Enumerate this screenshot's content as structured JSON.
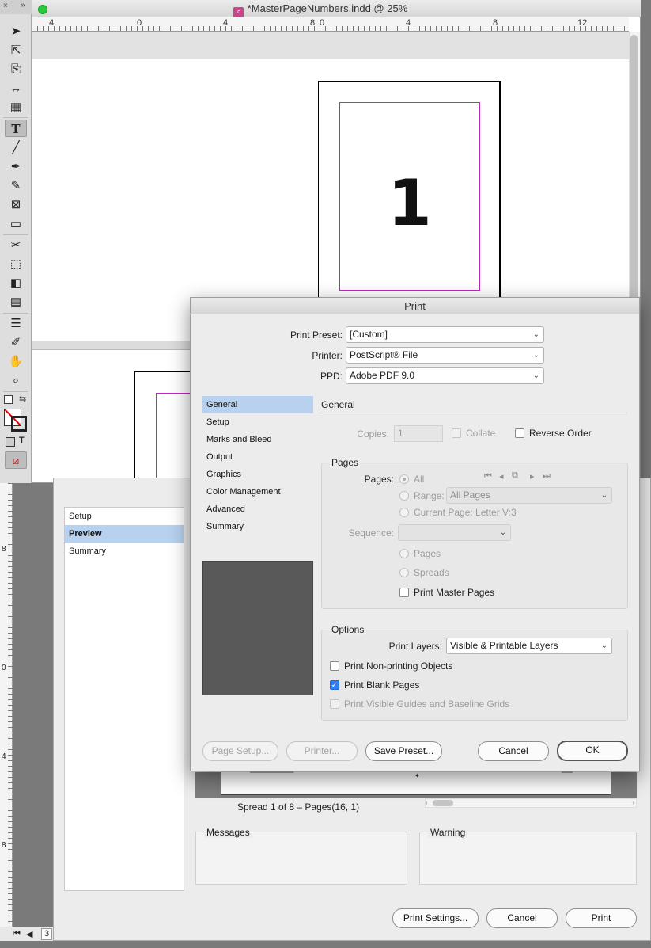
{
  "window": {
    "title": "*MasterPageNumbers.indd @ 25%",
    "ruler_top_labels": [
      "4",
      "0",
      "4",
      "8",
      "0",
      "4",
      "8",
      "12"
    ],
    "ruler_left_labels": [
      "8",
      "0",
      "4",
      "8"
    ],
    "page_number": "1",
    "page_field": "3"
  },
  "tools": [
    {
      "icon": "selection-arrow-icon",
      "glyph": "➤"
    },
    {
      "icon": "direct-selection-icon",
      "glyph": "⇱"
    },
    {
      "icon": "page-tool-icon",
      "glyph": "⎘"
    },
    {
      "icon": "gap-tool-icon",
      "glyph": "↔"
    },
    {
      "icon": "content-collector-icon",
      "glyph": "▦"
    },
    {
      "icon": "type-tool-icon",
      "glyph": "T"
    },
    {
      "icon": "line-tool-icon",
      "glyph": "╱"
    },
    {
      "icon": "pen-tool-icon",
      "glyph": "✒"
    },
    {
      "icon": "pencil-tool-icon",
      "glyph": "✎"
    },
    {
      "icon": "rectangle-frame-icon",
      "glyph": "⊠"
    },
    {
      "icon": "rectangle-tool-icon",
      "glyph": "▭"
    },
    {
      "icon": "scissors-icon",
      "glyph": "✂"
    },
    {
      "icon": "free-transform-icon",
      "glyph": "⬚"
    },
    {
      "icon": "gradient-swatch-icon",
      "glyph": "◧"
    },
    {
      "icon": "gradient-feather-icon",
      "glyph": "▤"
    },
    {
      "icon": "note-tool-icon",
      "glyph": "☰"
    },
    {
      "icon": "eyedropper-icon",
      "glyph": "✐"
    },
    {
      "icon": "hand-tool-icon",
      "glyph": "✋"
    },
    {
      "icon": "zoom-tool-icon",
      "glyph": "⌕"
    }
  ],
  "print_dialog": {
    "title": "Print",
    "preset_label": "Print Preset:",
    "preset_value": "[Custom]",
    "printer_label": "Printer:",
    "printer_value": "PostScript® File",
    "ppd_label": "PPD:",
    "ppd_value": "Adobe PDF 9.0",
    "sidebar": [
      "General",
      "Setup",
      "Marks and Bleed",
      "Output",
      "Graphics",
      "Color Management",
      "Advanced",
      "Summary"
    ],
    "active_section": "General",
    "section_title": "General",
    "copies_label": "Copies:",
    "copies_value": "1",
    "collate_label": "Collate",
    "reverse_order_label": "Reverse Order",
    "pages_group": "Pages",
    "pages_label": "Pages:",
    "all_label": "All",
    "range_label": "Range:",
    "range_value": "All Pages",
    "current_page_label": "Current Page: Letter V:3",
    "sequence_label": "Sequence:",
    "sequence_value": "",
    "pages_option": "Pages",
    "spreads_option": "Spreads",
    "print_master_pages": "Print Master Pages",
    "options_group": "Options",
    "print_layers_label": "Print Layers:",
    "print_layers_value": "Visible & Printable Layers",
    "print_nonprinting": "Print Non-printing Objects",
    "print_blank_pages": "Print Blank Pages",
    "print_guides": "Print Visible Guides and Baseline Grids",
    "buttons": {
      "page_setup": "Page Setup...",
      "printer": "Printer...",
      "save_preset": "Save Preset...",
      "cancel": "Cancel",
      "ok": "OK"
    }
  },
  "background_dialog": {
    "sidebar": [
      "Setup",
      "Preview",
      "Summary"
    ],
    "active_section": "Preview",
    "spread_info": "Spread 1 of 8 – Pages(16, 1)",
    "messages_label": "Messages",
    "warning_label": "Warning",
    "buttons": {
      "print_settings": "Print Settings...",
      "cancel": "Cancel",
      "print": "Print"
    }
  },
  "colors": {
    "accent": "#2f7cf6",
    "selection": "#b7d1ee",
    "margin_guide": "#c026c0"
  }
}
